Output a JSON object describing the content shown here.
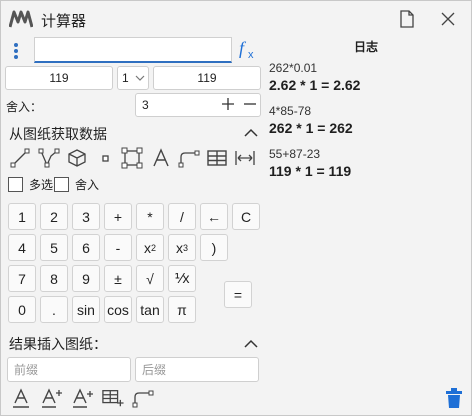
{
  "window": {
    "title": "计算器"
  },
  "input": {
    "expression": ""
  },
  "operands": {
    "left": "119",
    "selector": "1",
    "right": "119"
  },
  "rounding": {
    "label": "舍入：",
    "value": "3"
  },
  "drawing_section": {
    "title": "从图纸获取数据",
    "options": {
      "multi_select": "多选",
      "round": "舍入"
    }
  },
  "keypad": {
    "rows": [
      [
        "1",
        "2",
        "3",
        "+",
        "*",
        "/",
        "←",
        "C"
      ],
      [
        "4",
        "5",
        "6",
        "-",
        "x2",
        "x3",
        ")"
      ],
      [
        "7",
        "8",
        "9",
        "±",
        "√",
        "⅟x"
      ],
      [
        "0",
        ".",
        "sin",
        "cos",
        "tan",
        "π"
      ]
    ],
    "equals": "="
  },
  "insert_section": {
    "title": "结果插入图纸：",
    "prefix_placeholder": "前缀",
    "suffix_placeholder": "后缀"
  },
  "log": {
    "title": "日志",
    "entries": [
      {
        "expr": "262*0.01",
        "result": "2.62 * 1 = 2.62"
      },
      {
        "expr": "4*85-78",
        "result": "262 * 1 = 262"
      },
      {
        "expr": "55+87-23",
        "result": "119 * 1 = 119"
      }
    ]
  },
  "colors": {
    "accent": "#2f6fc0",
    "fx": "#1e6fd6",
    "trash": "#1e6fd6",
    "logo": "#555555"
  }
}
